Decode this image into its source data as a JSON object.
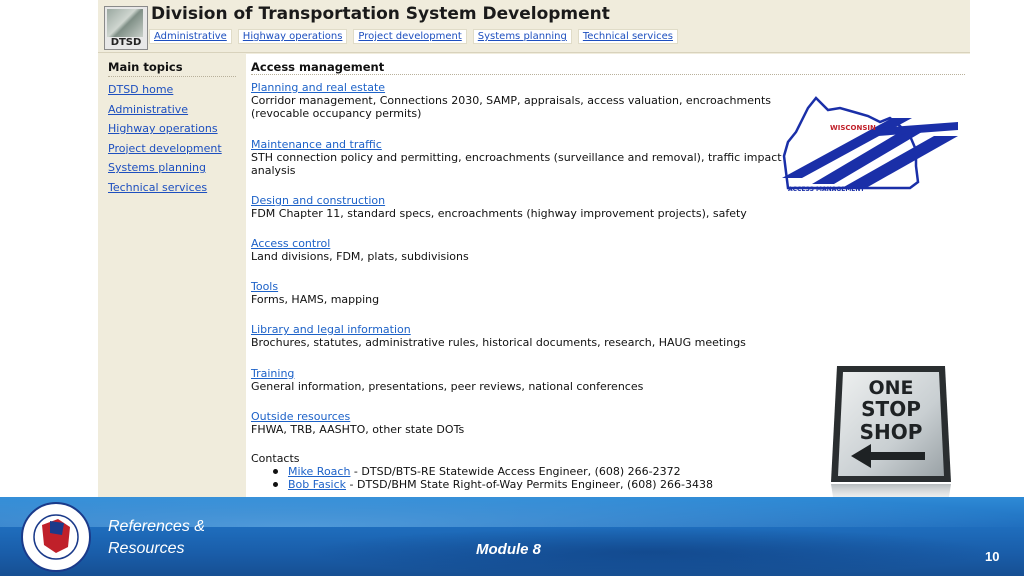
{
  "header": {
    "logo_text": "DTSD",
    "title": "Division of Transportation System Development",
    "nav": [
      "Administrative",
      "Highway operations",
      "Project development",
      "Systems planning",
      "Technical services"
    ]
  },
  "sidebar": {
    "title": "Main topics",
    "links": [
      "DTSD home",
      "Administrative",
      "Highway operations",
      "Project development",
      "Systems planning",
      "Technical services"
    ]
  },
  "main": {
    "title": "Access management",
    "sections": [
      {
        "link": "Planning and real estate",
        "desc": "Corridor management, Connections 2030, SAMP, appraisals, access valuation, encroachments (revocable occupancy permits)"
      },
      {
        "link": "Maintenance and traffic",
        "desc": "STH connection policy and permitting, encroachments (surveillance and removal), traffic impact analysis"
      },
      {
        "link": "Design and construction",
        "desc": "FDM Chapter 11, standard specs, encroachments (highway improvement projects), safety"
      },
      {
        "link": "Access control",
        "desc": "Land divisions, FDM, plats, subdivisions"
      },
      {
        "link": "Tools",
        "desc": "Forms, HAMS, mapping"
      },
      {
        "link": "Library and legal information",
        "desc": "Brochures, statutes, administrative rules, historical documents, research, HAUG meetings"
      },
      {
        "link": "Training",
        "desc": "General information, presentations, peer reviews, national conferences"
      },
      {
        "link": "Outside resources",
        "desc": "FHWA, TRB, AASHTO, other state DOTs"
      }
    ],
    "contacts_label": "Contacts",
    "contacts": [
      {
        "name": "Mike Roach",
        "detail": " - DTSD/BTS-RE Statewide Access Engineer, (608) 266-2372"
      },
      {
        "name": "Bob Fasick",
        "detail": " - DTSD/BHM State Right-of-Way Permits Engineer, (608) 266-3438"
      }
    ]
  },
  "images": {
    "wisconsin_logo": {
      "top_text": "WISCONSIN",
      "bottom_text": "ACCESS MANAGEMENT"
    },
    "sign": {
      "lines": [
        "ONE",
        "STOP",
        "SHOP"
      ]
    }
  },
  "footer": {
    "title_line1": "References &",
    "title_line2": "Resources",
    "module": "Module 8",
    "page_number": "10"
  },
  "colors": {
    "link": "#1d62c8",
    "page_bg": "#f0ecdc",
    "footer_blue": "#1f6fbf"
  }
}
